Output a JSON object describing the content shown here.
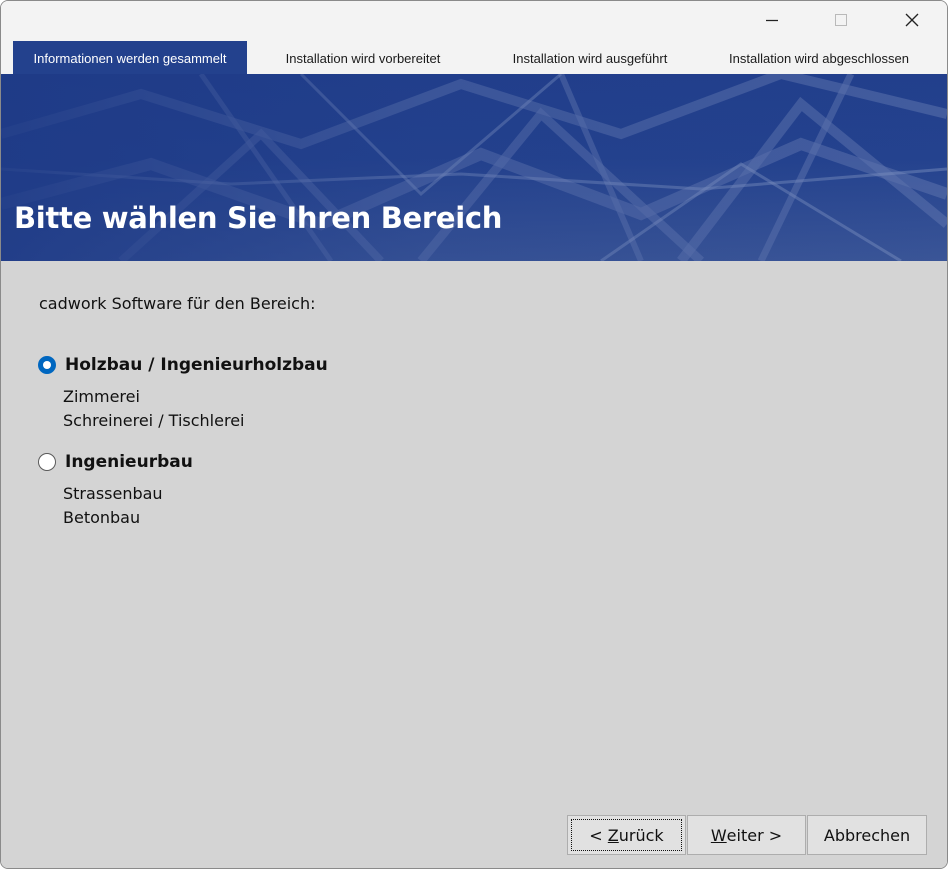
{
  "window": {
    "controls": {
      "minimize_icon": "minimize-icon",
      "maximize_icon": "maximize-icon",
      "close_icon": "close-icon"
    }
  },
  "steps": [
    {
      "label": "Informationen werden gesammelt",
      "active": true
    },
    {
      "label": "Installation wird vorbereitet",
      "active": false
    },
    {
      "label": "Installation wird ausgeführt",
      "active": false
    },
    {
      "label": "Installation wird abgeschlossen",
      "active": false
    }
  ],
  "banner": {
    "title": "Bitte wählen Sie Ihren Bereich"
  },
  "content": {
    "intro": "cadwork Software für den Bereich:",
    "options": [
      {
        "label": "Holzbau / Ingenieurholzbau",
        "selected": true,
        "items": [
          "Zimmerei",
          "Schreinerei / Tischlerei"
        ]
      },
      {
        "label": "Ingenieurbau",
        "selected": false,
        "items": [
          "Strassenbau",
          "Betonbau"
        ]
      }
    ]
  },
  "buttons": {
    "back": {
      "prefix": "< ",
      "mnemonic": "Z",
      "rest": "urück"
    },
    "next": {
      "mnemonic": "W",
      "rest": "eiter >"
    },
    "cancel": "Abbrechen"
  },
  "colors": {
    "accent": "#23418d",
    "radio_selected": "#0067c0",
    "content_bg": "#d4d4d4"
  }
}
